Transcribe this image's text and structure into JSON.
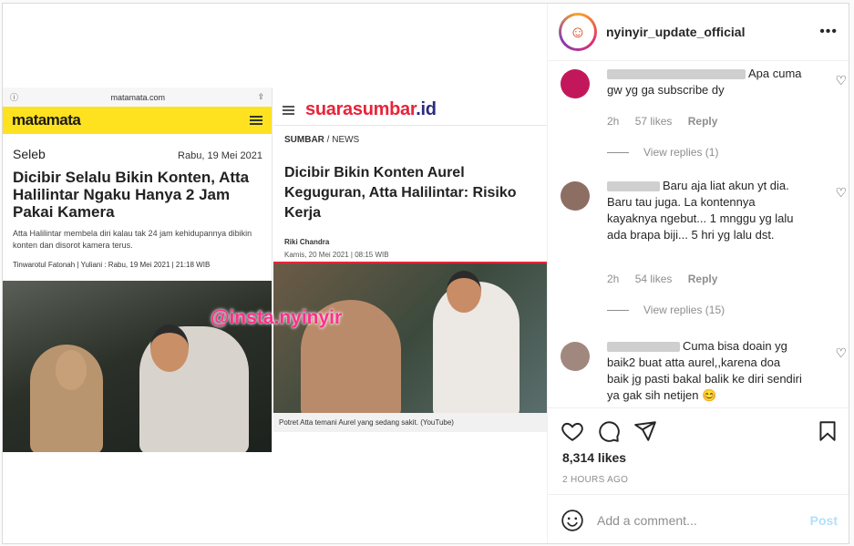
{
  "post_image": {
    "left_article": {
      "browser_url": "matamata.com",
      "logo": "matamata",
      "category": "Seleb",
      "date": "Rabu, 19 Mei 2021",
      "title": "Dicibir Selalu Bikin Konten, Atta Halilintar Ngaku Hanya 2 Jam Pakai Kamera",
      "lead": "Atta Halilintar membela diri kalau tak 24 jam kehidupannya dibikin konten dan disorot kamera terus.",
      "byline": "Tinwarotul Fatonah | Yuliani : Rabu, 19 Mei 2021 | 21:18 WIB",
      "watermark": "@insta.nyinyir"
    },
    "right_article": {
      "logo_main": "suarasumbar",
      "logo_suffix": ".id",
      "crumb_section": "SUMBAR",
      "crumb_sub": "/ NEWS",
      "title": "Dicibir Bikin Konten Aurel Keguguran, Atta Halilintar: Risiko Kerja",
      "author": "Riki Chandra",
      "date": "Kamis, 20 Mei 2021 | 08:15 WIB",
      "caption": "Potret Atta temani Aurel yang sedang sakit. (YouTube)"
    }
  },
  "header": {
    "username": "nyinyir_update_official",
    "more": "•••"
  },
  "comments": [
    {
      "text": "Apa cuma gw yg ga subscribe dy",
      "age": "2h",
      "likes": "57 likes",
      "reply": "Reply",
      "view_replies": "View replies (1)",
      "avatar_color": "#c2185b"
    },
    {
      "text": "Baru aja liat akun yt dia. Baru tau juga. La kontennya kayaknya ngebut... 1 mnggu yg lalu ada brapa biji... 5 hri yg lalu dst.",
      "age": "2h",
      "likes": "54 likes",
      "reply": "Reply",
      "view_replies": "View replies (15)",
      "avatar_color": "#8d6e63"
    },
    {
      "text": "Cuma bisa doain yg baik2 buat atta aurel,,karena doa baik jg pasti bakal balik ke diri sendiri ya gak sih netijen 😊",
      "avatar_color": "#a1887f"
    }
  ],
  "likes_count": "8,314 likes",
  "timestamp": "2 HOURS AGO",
  "add_comment": {
    "placeholder": "Add a comment...",
    "post_label": "Post"
  }
}
